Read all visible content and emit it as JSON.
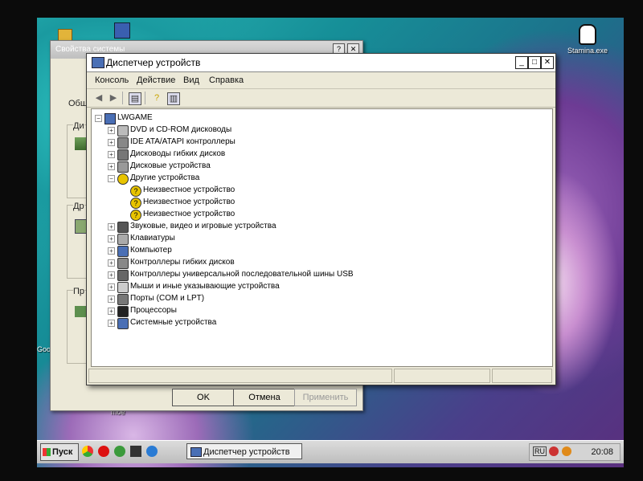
{
  "desktop": {
    "icons": [
      {
        "label": "Stamina.exe",
        "icon": "penguin-icon"
      },
      {
        "label": "Goo",
        "icon": "google-icon"
      },
      {
        "label": "moe",
        "icon": "folder-icon"
      }
    ]
  },
  "props_window": {
    "title": "Свойства системы",
    "tab_label": "Общ",
    "group1_label": "Ди",
    "group2_label": "Др",
    "group3_label": "Пр",
    "ok_label": "OK",
    "cancel_label": "Отмена",
    "apply_label": "Применить"
  },
  "devmgr": {
    "title": "Диспетчер устройств",
    "menu": [
      "Консоль",
      "Действие",
      "Вид",
      "Справка"
    ],
    "toolbar_icons": [
      "back-arrow-icon",
      "forward-arrow-icon",
      "properties-view-icon",
      "help-icon",
      "device-list-icon"
    ],
    "root": "LWGAME",
    "categories": [
      {
        "label": "DVD и CD-ROM дисководы",
        "icon": "cdrom-icon",
        "expanded": false
      },
      {
        "label": "IDE ATA/ATAPI контроллеры",
        "icon": "ide-controller-icon",
        "expanded": false
      },
      {
        "label": "Дисководы гибких дисков",
        "icon": "floppy-drive-icon",
        "expanded": false
      },
      {
        "label": "Дисковые устройства",
        "icon": "disk-drive-icon",
        "expanded": false
      },
      {
        "label": "Другие устройства",
        "icon": "unknown-device-icon",
        "expanded": true,
        "children": [
          "Неизвестное устройство",
          "Неизвестное устройство",
          "Неизвестное устройство"
        ]
      },
      {
        "label": "Звуковые, видео и игровые устройства",
        "icon": "sound-icon",
        "expanded": false
      },
      {
        "label": "Клавиатуры",
        "icon": "keyboard-icon",
        "expanded": false
      },
      {
        "label": "Компьютер",
        "icon": "computer-icon",
        "expanded": false
      },
      {
        "label": "Контроллеры гибких дисков",
        "icon": "floppy-controller-icon",
        "expanded": false
      },
      {
        "label": "Контроллеры универсальной последовательной шины USB",
        "icon": "usb-icon",
        "expanded": false
      },
      {
        "label": "Мыши и иные указывающие устройства",
        "icon": "mouse-icon",
        "expanded": false
      },
      {
        "label": "Порты (COM и LPT)",
        "icon": "port-icon",
        "expanded": false
      },
      {
        "label": "Процессоры",
        "icon": "processor-icon",
        "expanded": false
      },
      {
        "label": "Системные устройства",
        "icon": "system-device-icon",
        "expanded": false
      }
    ]
  },
  "taskbar": {
    "start_label": "Пуск",
    "task_label": "Диспетчер устройств",
    "clock": "20:08",
    "tray_lang": "RU"
  }
}
